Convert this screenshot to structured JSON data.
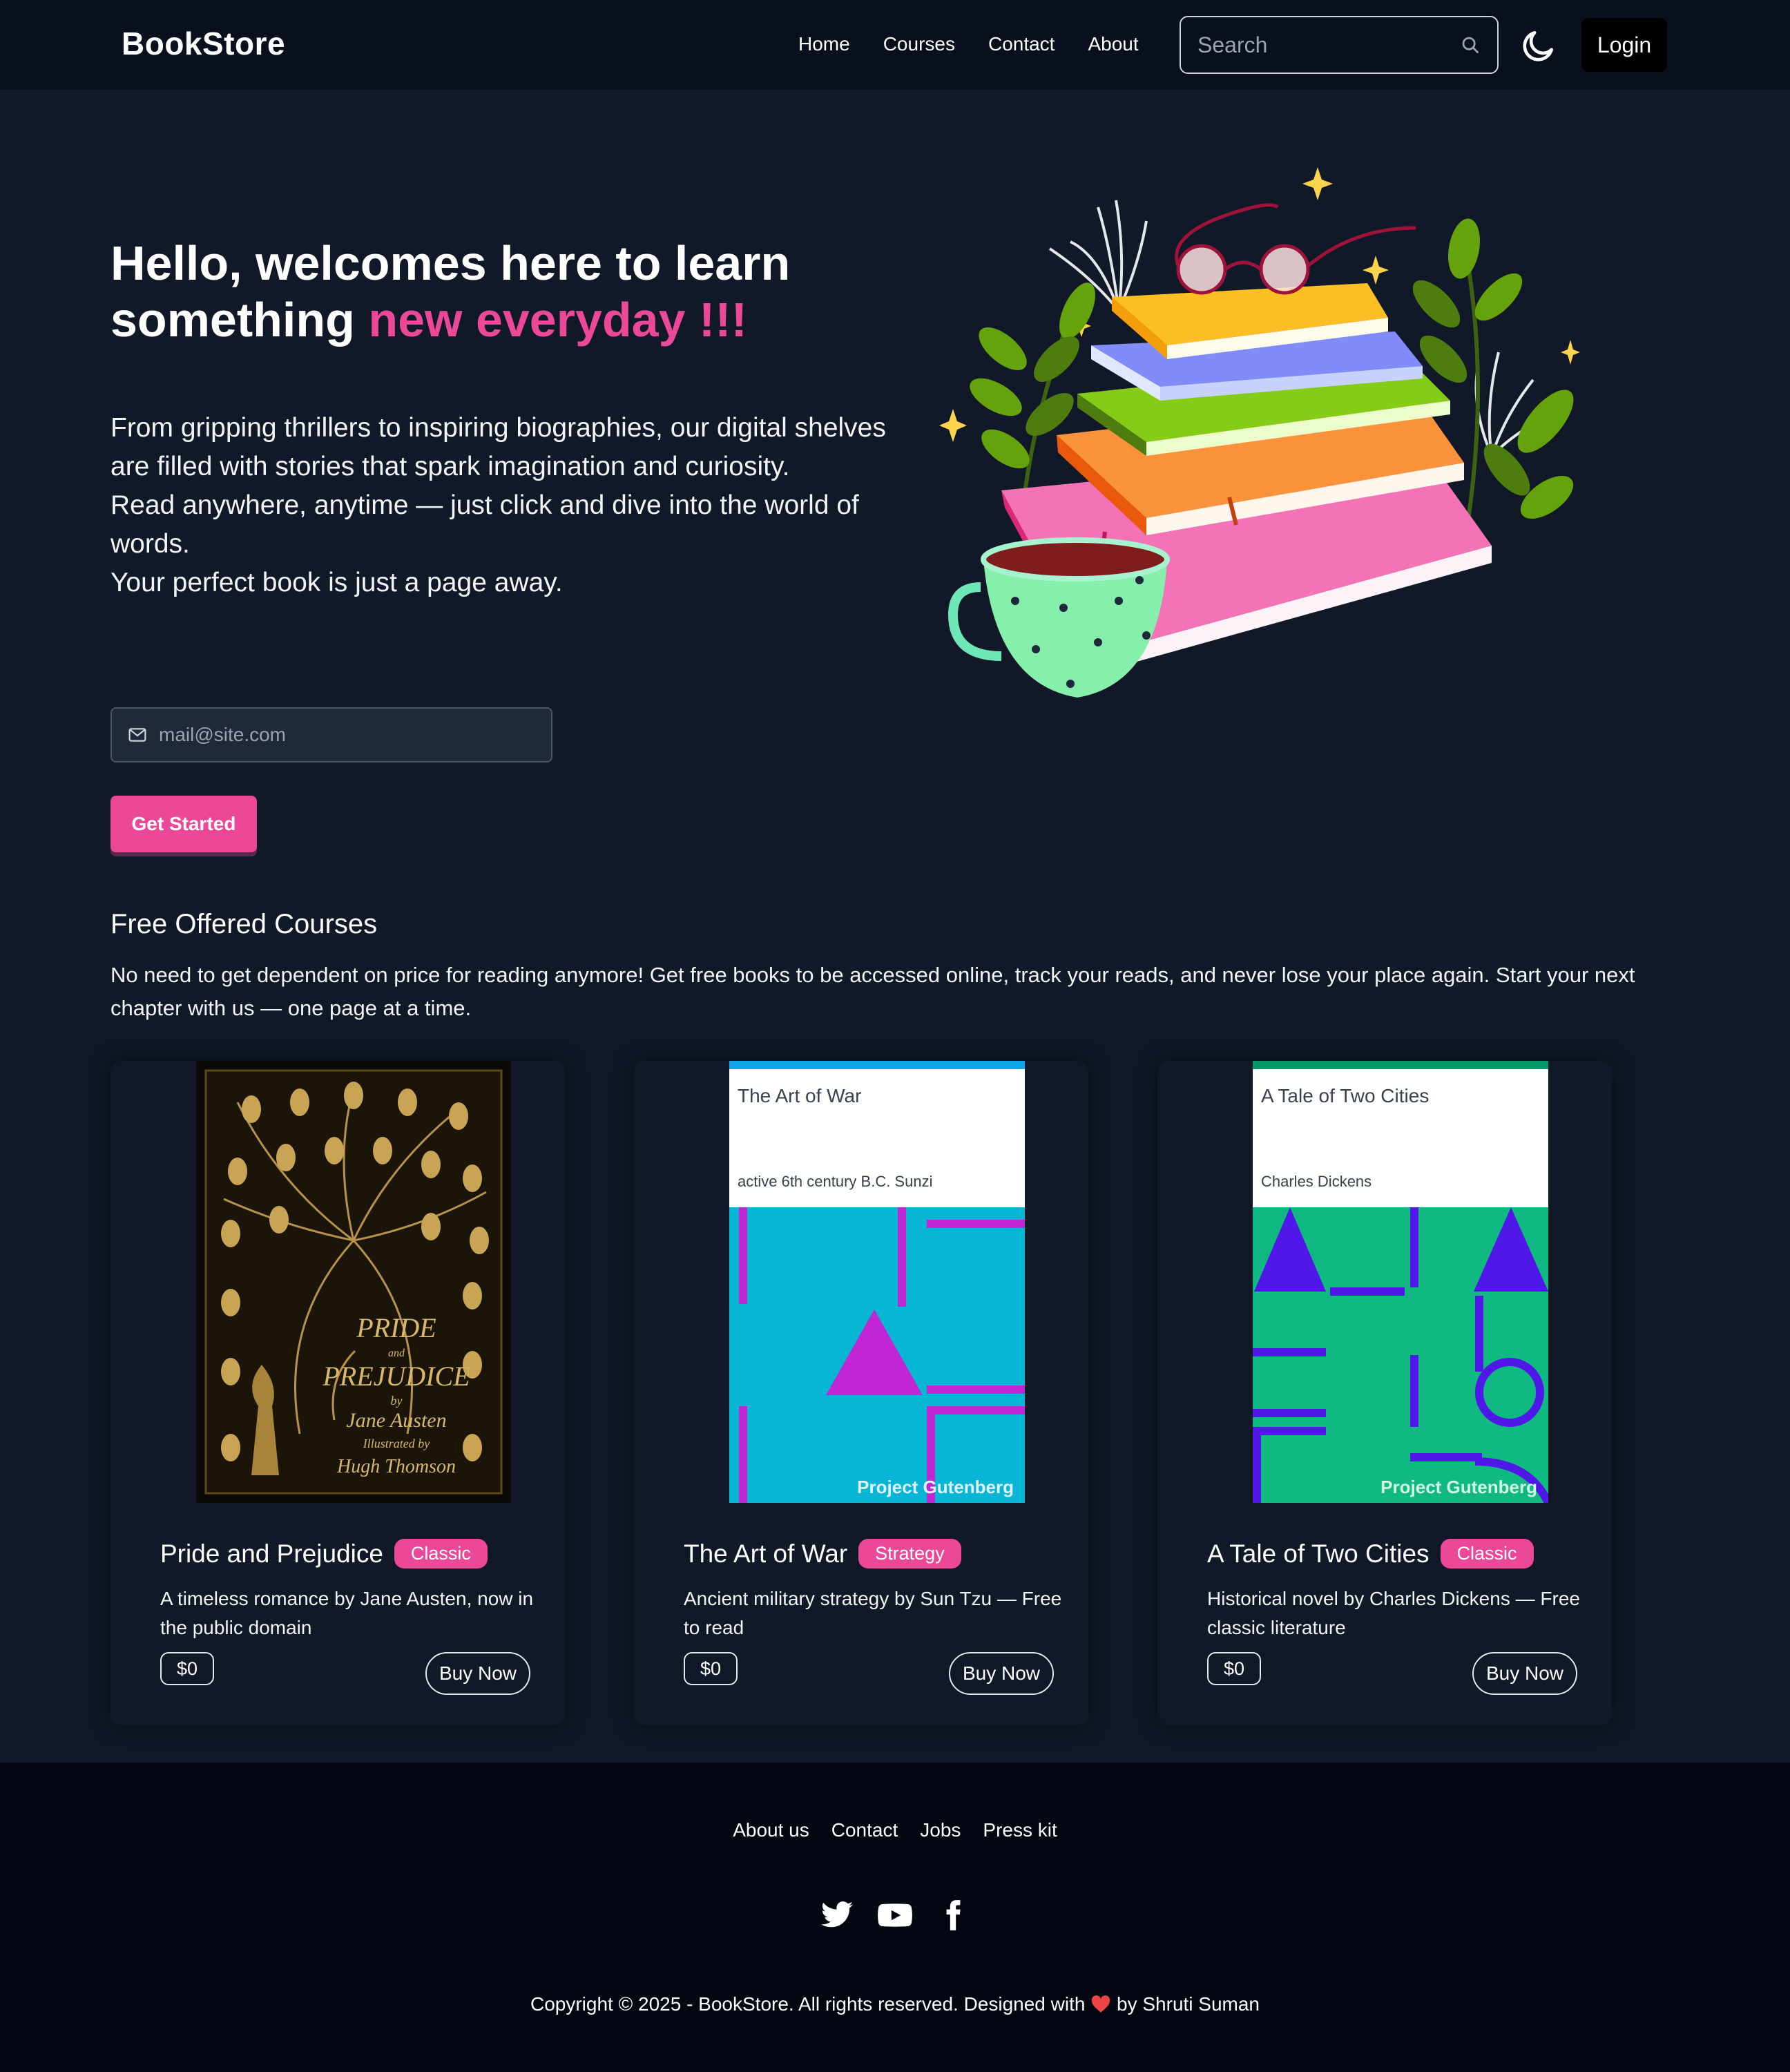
{
  "brand": "BookStore",
  "nav": {
    "links": [
      "Home",
      "Courses",
      "Contact",
      "About"
    ],
    "search_placeholder": "Search",
    "login_label": "Login"
  },
  "hero": {
    "title_line1": "Hello, welcomes here to learn",
    "title_line2_plain": "something ",
    "title_line2_accent": "new everyday !!!",
    "desc_line1": "From gripping thrillers to inspiring biographies, our digital shelves are filled with stories that spark imagination and curiosity.",
    "desc_line2": "Read anywhere, anytime — just click and dive into the world of words.",
    "desc_line3": "Your perfect book is just a page away.",
    "email_placeholder": "mail@site.com",
    "cta_label": "Get Started"
  },
  "courses": {
    "title": "Free Offered Courses",
    "description": "No need to get dependent on price for reading anymore! Get free books to be accessed online, track your reads, and never lose your place again. Start your next chapter with us — one page at a time.",
    "cards": [
      {
        "title": "Pride and Prejudice",
        "badge": "Classic",
        "description": "A timeless romance by Jane Austen, now in the public domain",
        "price": "$0",
        "buy_label": "Buy Now",
        "cover_lines": [
          "PRIDE",
          "and",
          "PREJUDICE",
          "by",
          "Jane Austen",
          "Illustrated by",
          "Hugh Thomson"
        ]
      },
      {
        "title": "The Art of War",
        "badge": "Strategy",
        "description": "Ancient military strategy by Sun Tzu — Free to read",
        "price": "$0",
        "buy_label": "Buy Now",
        "cover_title": "The Art of War",
        "cover_author": "active 6th century B.C. Sunzi",
        "cover_publisher": "Project Gutenberg"
      },
      {
        "title": "A Tale of Two Cities",
        "badge": "Classic",
        "description": "Historical novel by Charles Dickens — Free classic literature",
        "price": "$0",
        "buy_label": "Buy Now",
        "cover_title": "A Tale of Two Cities",
        "cover_author": "Charles Dickens",
        "cover_publisher": "Project Gutenberg"
      }
    ]
  },
  "footer": {
    "links": [
      "About us",
      "Contact",
      "Jobs",
      "Press kit"
    ],
    "socials": [
      "twitter-icon",
      "youtube-icon",
      "facebook-icon"
    ],
    "copyright_pre": "Copyright © 2025 - BookStore. All rights reserved. Designed with ",
    "copyright_post": " by Shruti Suman"
  },
  "colors": {
    "accent": "#ec4899",
    "background": "#111827",
    "nav_background": "#0a0f1e",
    "footer_background": "#030712"
  }
}
